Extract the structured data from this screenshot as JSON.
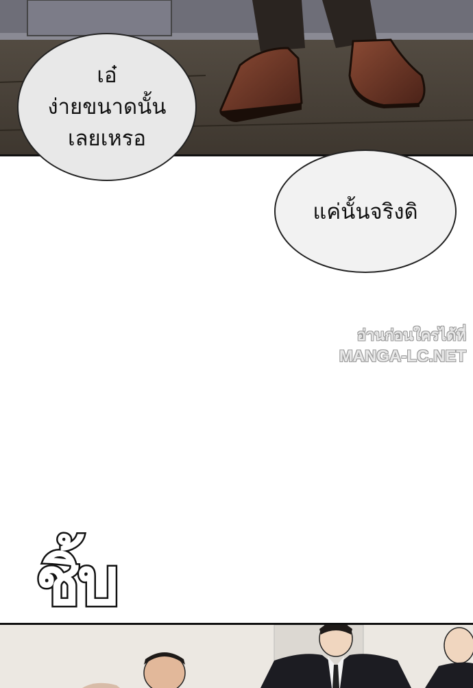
{
  "panel_1": {
    "speech_bubble_1": {
      "lines": [
        "เอ๋",
        "ง่ายขนาดนั้น",
        "เลยเหรอ"
      ]
    },
    "speech_bubble_2": {
      "text": "แค่นั้นจริงดิ"
    }
  },
  "watermark": {
    "line_1": "อ่านก่อนใครได้ที่",
    "line_2": "MANGA-LC.NET"
  },
  "sound_effect": {
    "text": "ชิ้บ"
  },
  "colors": {
    "bubble_fill": "#e8e8e8",
    "bubble_border": "#222222",
    "floor": "#4a4238",
    "shoe": "#6b3324"
  }
}
